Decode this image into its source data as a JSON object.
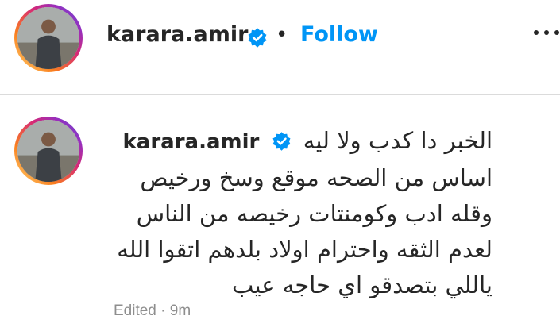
{
  "post_header": {
    "username": "karara.amir",
    "separator": "•",
    "follow_label": "Follow",
    "more_icon": "more-horizontal-icon",
    "verified_icon": "verified-badge-icon"
  },
  "comment": {
    "username": "karara.amir",
    "lines": [
      "الخبر دا كدب ولا ليه",
      "اساس من الصحه موقع وسخ ورخيص",
      "وقله ادب وكومنتات رخيصه من الناس",
      "لعدم الثقه واحترام اولاد بلدهم اتقوا الله",
      "ياللي بتصدقو اي حاجه عيب"
    ],
    "meta": "Edited · 9m"
  },
  "colors": {
    "follow_blue": "#0095f6",
    "verified_blue": "#0095f6",
    "text": "#262626",
    "secondary_text": "#8e8e8e"
  }
}
